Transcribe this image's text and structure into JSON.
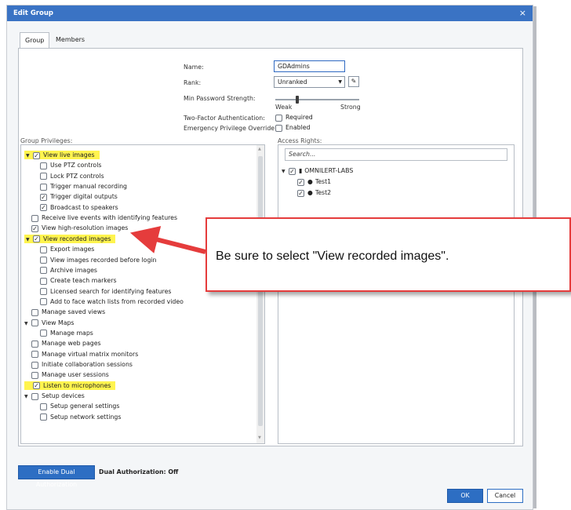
{
  "window": {
    "title": "Edit Group",
    "close_glyph": "×"
  },
  "tabs": [
    {
      "label": "Group",
      "active": true
    },
    {
      "label": "Members",
      "active": false
    }
  ],
  "form": {
    "name_label": "Name:",
    "name_value": "GDAdmins",
    "rank_label": "Rank:",
    "rank_value": "Unranked",
    "min_pw_label": "Min Password Strength:",
    "slider_min": "Weak",
    "slider_max": "Strong",
    "slider_level": 0.25,
    "twofactor_label": "Two-Factor Authentication:",
    "twofactor_option": "Required",
    "emergency_label": "Emergency Privilege Override:",
    "emergency_option": "Enabled"
  },
  "privileges": {
    "title": "Group Privileges:",
    "items": [
      {
        "label": "View live images",
        "level": 0,
        "caret": true,
        "checked": true,
        "highlight": true
      },
      {
        "label": "Use PTZ controls",
        "level": 1,
        "checked": false
      },
      {
        "label": "Lock PTZ controls",
        "level": 1,
        "checked": false
      },
      {
        "label": "Trigger manual recording",
        "level": 1,
        "checked": false
      },
      {
        "label": "Trigger digital outputs",
        "level": 1,
        "checked": true
      },
      {
        "label": "Broadcast to speakers",
        "level": 1,
        "checked": true
      },
      {
        "label": "Receive live events with identifying features",
        "level": 0,
        "checked": false
      },
      {
        "label": "View high-resolution images",
        "level": 0,
        "checked": true
      },
      {
        "label": "View recorded images",
        "level": 0,
        "caret": true,
        "checked": true,
        "highlight": true
      },
      {
        "label": "Export images",
        "level": 1,
        "checked": false
      },
      {
        "label": "View images recorded before login",
        "level": 1,
        "checked": false
      },
      {
        "label": "Archive images",
        "level": 1,
        "checked": false
      },
      {
        "label": "Create teach markers",
        "level": 1,
        "checked": false
      },
      {
        "label": "Licensed search for identifying features",
        "level": 1,
        "checked": false
      },
      {
        "label": "Add to face watch lists from recorded video",
        "level": 1,
        "checked": false
      },
      {
        "label": "Manage saved views",
        "level": 0,
        "checked": false
      },
      {
        "label": "View Maps",
        "level": 0,
        "caret": true,
        "checked": false
      },
      {
        "label": "Manage maps",
        "level": 1,
        "checked": false
      },
      {
        "label": "Manage web pages",
        "level": 0,
        "checked": false
      },
      {
        "label": "Manage virtual matrix monitors",
        "level": 0,
        "checked": false
      },
      {
        "label": "Initiate collaboration sessions",
        "level": 0,
        "checked": false
      },
      {
        "label": "Manage user sessions",
        "level": 0,
        "checked": false
      },
      {
        "label": "Listen to microphones",
        "level": 0,
        "checked": true,
        "highlight": true
      },
      {
        "label": "Setup devices",
        "level": 0,
        "caret": true,
        "checked": false
      },
      {
        "label": "Setup general settings",
        "level": 1,
        "checked": false
      },
      {
        "label": "Setup network settings",
        "level": 1,
        "checked": false
      }
    ]
  },
  "access": {
    "title": "Access Rights:",
    "search_placeholder": "Search...",
    "tree": [
      {
        "label": "OMNILERT-LABS",
        "level": 0,
        "caret": true,
        "checked": true,
        "icon": "server-icon"
      },
      {
        "label": "Test1",
        "level": 1,
        "checked": true,
        "icon": "camera-icon"
      },
      {
        "label": "Test2",
        "level": 1,
        "checked": true,
        "icon": "camera-icon"
      }
    ]
  },
  "footer": {
    "dual_auth_button": "Enable Dual Authorization",
    "dual_auth_status": "Dual Authorization: Off",
    "ok_label": "OK",
    "cancel_label": "Cancel"
  },
  "annotation": {
    "callout_text": "Be sure to select \"View recorded images\".",
    "arrow_color": "#e53c3c",
    "highlight_color": "#fff44f",
    "accent_color": "#2d6ec3"
  }
}
